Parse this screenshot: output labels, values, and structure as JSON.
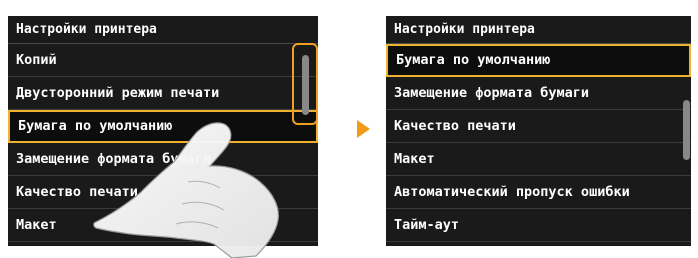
{
  "left_screen": {
    "title": "Настройки принтера",
    "items": [
      {
        "label": "Копий",
        "selected": false
      },
      {
        "label": "Двусторонний режим печати",
        "selected": false
      },
      {
        "label": "Бумага по умолчанию",
        "selected": true
      },
      {
        "label": "Замещение формата бумаги",
        "selected": false
      },
      {
        "label": "Качество печати",
        "selected": false
      },
      {
        "label": "Макет",
        "selected": false
      }
    ]
  },
  "right_screen": {
    "title": "Настройки принтера",
    "items": [
      {
        "label": "Бумага по умолчанию",
        "selected": true
      },
      {
        "label": "Замещение формата бумаги",
        "selected": false
      },
      {
        "label": "Качество печати",
        "selected": false
      },
      {
        "label": "Макет",
        "selected": false
      },
      {
        "label": "Автоматический пропуск ошибки",
        "selected": false
      },
      {
        "label": "Тайм-аут",
        "selected": false
      }
    ]
  },
  "colors": {
    "selection_border": "#f0b030",
    "arrow": "#f29a1a",
    "screen_background": "#1a1a1a"
  },
  "icons": {
    "transition_arrow": "right-triangle-icon",
    "gesture_hand": "pointing-hand-icon"
  }
}
